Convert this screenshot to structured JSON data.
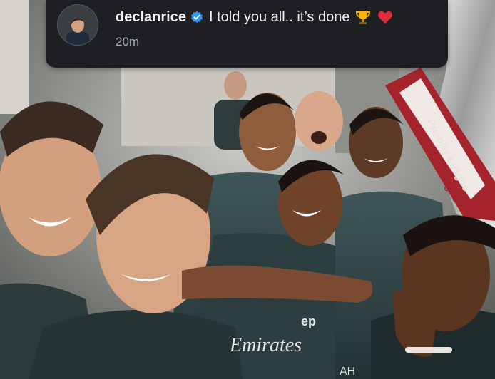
{
  "post": {
    "username": "declanrice",
    "caption": "I told you all.. it’s done",
    "time": "20m",
    "icons": [
      "verified-badge-icon",
      "trophy-icon",
      "red-heart-icon"
    ]
  },
  "photo": {
    "banner_text_1": "Premier League",
    "banner_text_2": "Premier League",
    "shirt_text": "Emirates",
    "shirt_number": "ep",
    "shirt_text_corner": "AH"
  },
  "colors": {
    "notification_bg": "#1e1f22",
    "verified_blue": "#3797f0",
    "text": "#f2f2f2",
    "muted": "#a8abb0"
  }
}
